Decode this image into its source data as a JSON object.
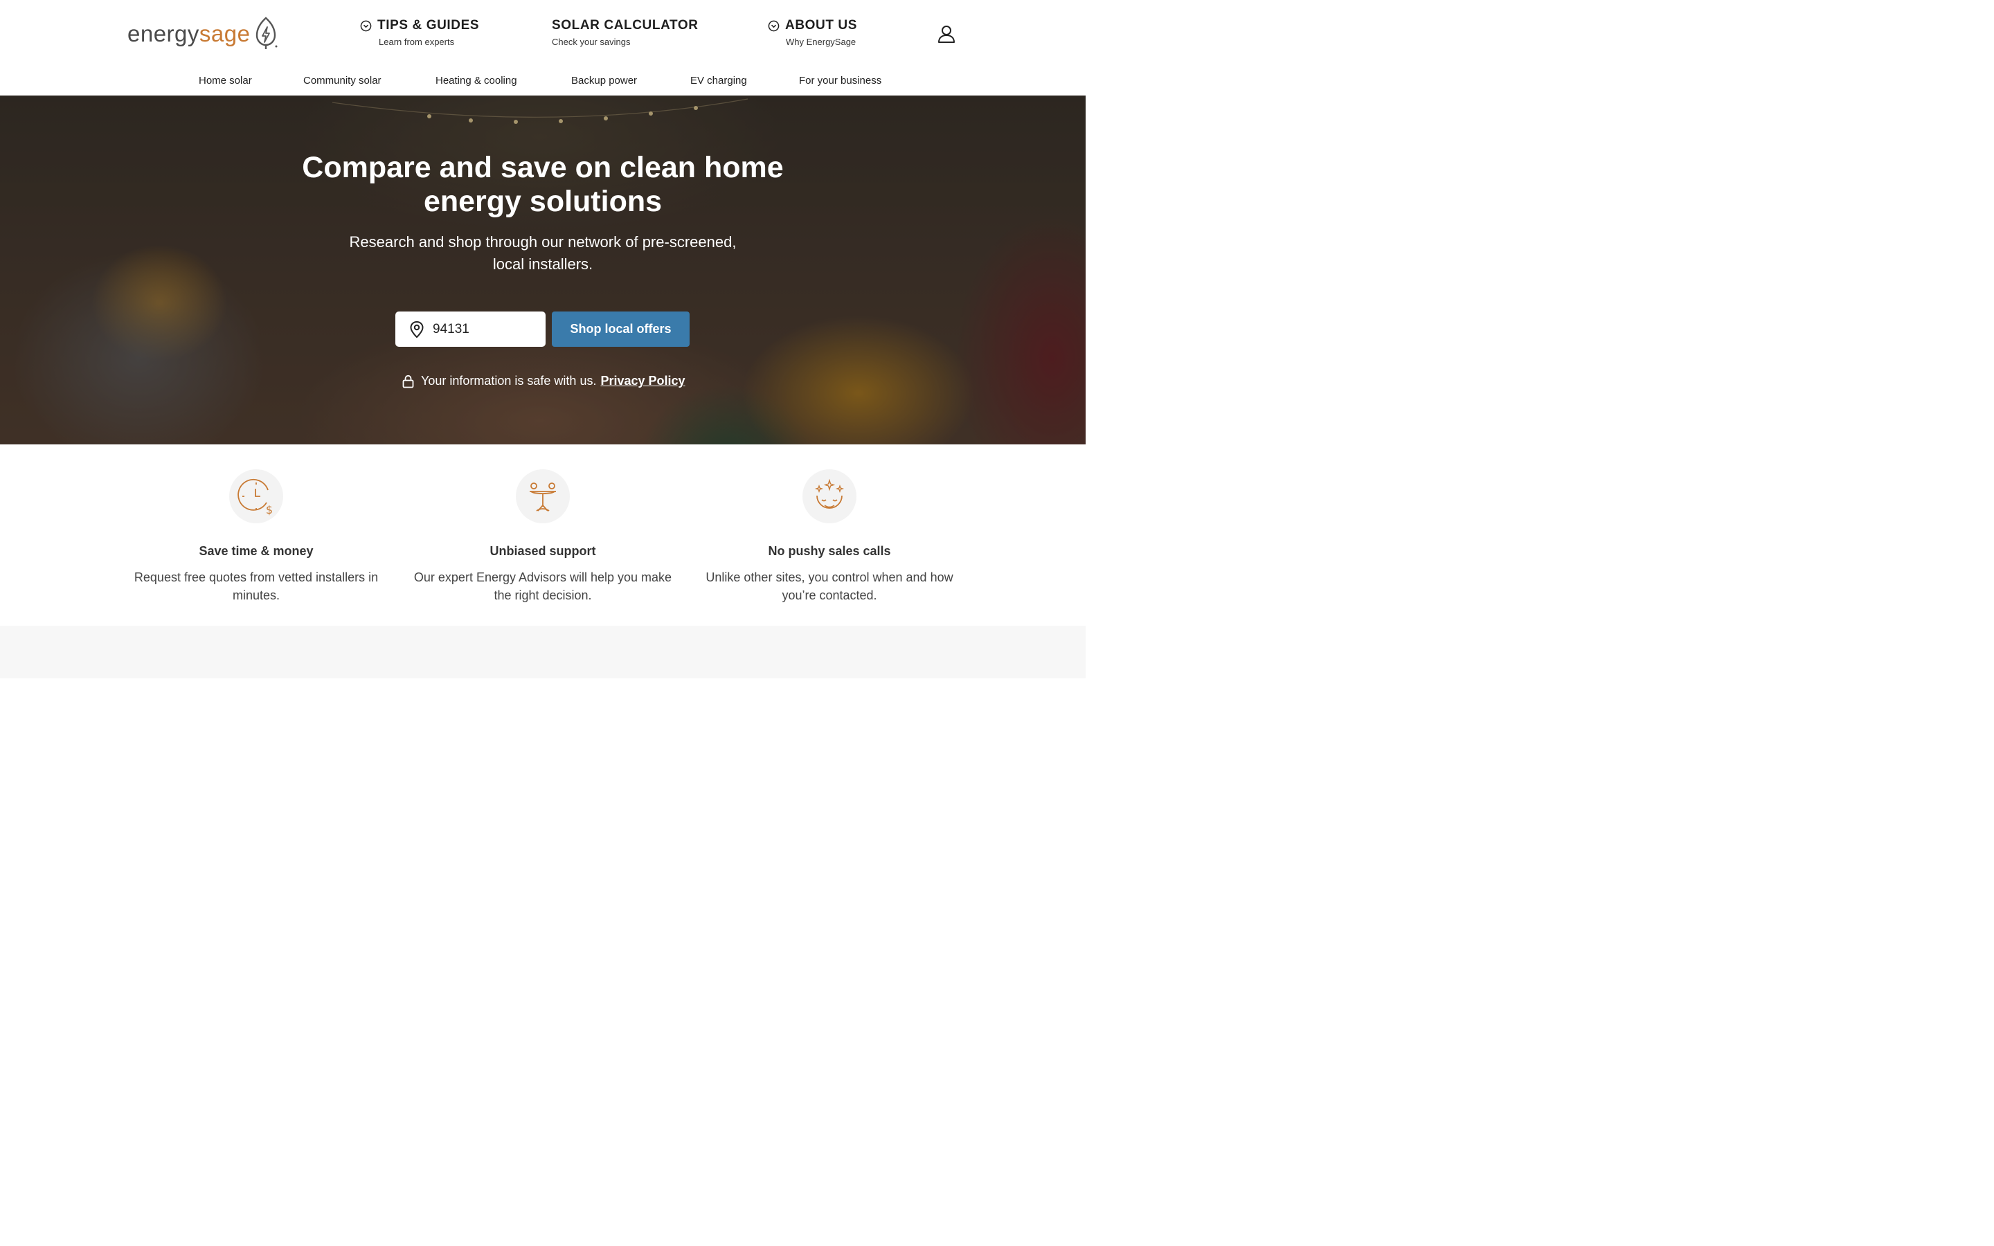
{
  "brand": {
    "logo_part1": "energy",
    "logo_part2": "sage",
    "accent_color": "#c87a34"
  },
  "top_nav": [
    {
      "label": "TIPS & GUIDES",
      "sub": "Learn from experts",
      "has_dropdown": true
    },
    {
      "label": "SOLAR CALCULATOR",
      "sub": "Check your savings",
      "has_dropdown": false
    },
    {
      "label": "ABOUT US",
      "sub": "Why EnergySage",
      "has_dropdown": true
    }
  ],
  "category_nav": [
    "Home solar",
    "Community solar",
    "Heating & cooling",
    "Backup power",
    "EV charging",
    "For your business"
  ],
  "hero": {
    "title": "Compare and save on clean home energy solutions",
    "subtitle": "Research and shop through our network of pre-screened, local installers.",
    "zip_value": "94131",
    "cta_label": "Shop local offers",
    "cta_color": "#3a7bab",
    "privacy_text": "Your information is safe with us.",
    "privacy_link": "Privacy Policy"
  },
  "features": [
    {
      "icon": "clock-dollar-icon",
      "title": "Save time & money",
      "text": "Request free quotes from vetted installers in minutes."
    },
    {
      "icon": "balance-scale-icon",
      "title": "Unbiased support",
      "text": "Our expert Energy Advisors will help you make the right decision."
    },
    {
      "icon": "calm-face-sparkles-icon",
      "title": "No pushy sales calls",
      "text": "Unlike other sites, you control when and how you’re contacted."
    }
  ]
}
